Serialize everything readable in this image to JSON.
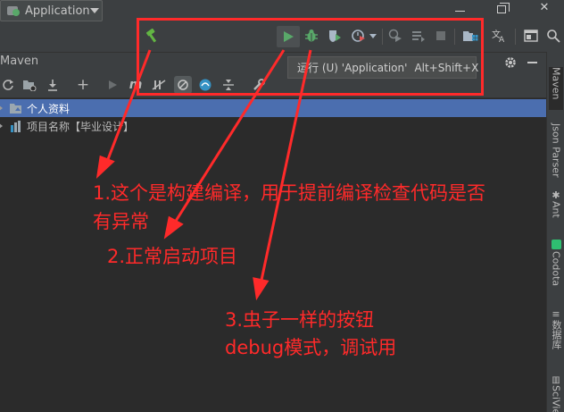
{
  "toolbar": {
    "run_config_label": "Application",
    "tooltip_text": "运行 (U) 'Application'",
    "tooltip_shortcut": "Alt+Shift+X"
  },
  "maven": {
    "title": "Maven",
    "tree": [
      {
        "label": "个人资料",
        "selected": true
      },
      {
        "label": "项目名称【毕业设计】",
        "selected": false
      }
    ]
  },
  "right_stripe": [
    "Maven",
    "Json Parser",
    "Ant",
    "Codota",
    "数据库",
    "SciVie"
  ],
  "annotations": {
    "note1_line1": "1.这个是构建编译，用于提前编译检查代码是否",
    "note1_line2": "有异常",
    "note2": "2.正常启动项目",
    "note3_line1": "3.虫子一样的按钮",
    "note3_line2": "debug模式，调试用"
  },
  "colors": {
    "annotation": "#ff2a2a",
    "run_green": "#59a869",
    "selection": "#4b6eaf"
  }
}
